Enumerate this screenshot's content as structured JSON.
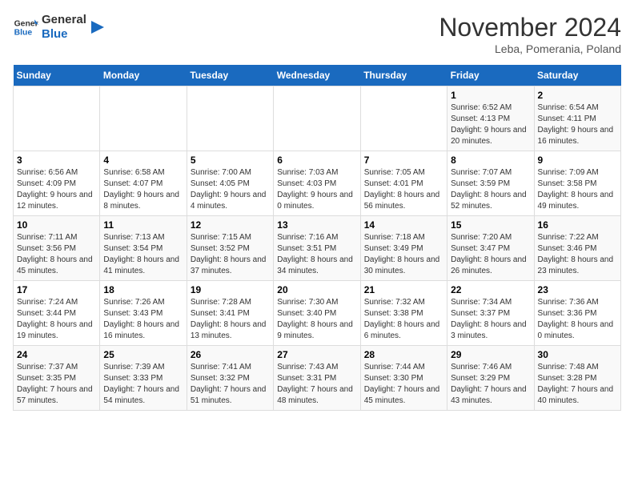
{
  "logo": {
    "text_general": "General",
    "text_blue": "Blue"
  },
  "header": {
    "month": "November 2024",
    "location": "Leba, Pomerania, Poland"
  },
  "weekdays": [
    "Sunday",
    "Monday",
    "Tuesday",
    "Wednesday",
    "Thursday",
    "Friday",
    "Saturday"
  ],
  "weeks": [
    [
      {
        "day": "",
        "info": ""
      },
      {
        "day": "",
        "info": ""
      },
      {
        "day": "",
        "info": ""
      },
      {
        "day": "",
        "info": ""
      },
      {
        "day": "",
        "info": ""
      },
      {
        "day": "1",
        "info": "Sunrise: 6:52 AM\nSunset: 4:13 PM\nDaylight: 9 hours and 20 minutes."
      },
      {
        "day": "2",
        "info": "Sunrise: 6:54 AM\nSunset: 4:11 PM\nDaylight: 9 hours and 16 minutes."
      }
    ],
    [
      {
        "day": "3",
        "info": "Sunrise: 6:56 AM\nSunset: 4:09 PM\nDaylight: 9 hours and 12 minutes."
      },
      {
        "day": "4",
        "info": "Sunrise: 6:58 AM\nSunset: 4:07 PM\nDaylight: 9 hours and 8 minutes."
      },
      {
        "day": "5",
        "info": "Sunrise: 7:00 AM\nSunset: 4:05 PM\nDaylight: 9 hours and 4 minutes."
      },
      {
        "day": "6",
        "info": "Sunrise: 7:03 AM\nSunset: 4:03 PM\nDaylight: 9 hours and 0 minutes."
      },
      {
        "day": "7",
        "info": "Sunrise: 7:05 AM\nSunset: 4:01 PM\nDaylight: 8 hours and 56 minutes."
      },
      {
        "day": "8",
        "info": "Sunrise: 7:07 AM\nSunset: 3:59 PM\nDaylight: 8 hours and 52 minutes."
      },
      {
        "day": "9",
        "info": "Sunrise: 7:09 AM\nSunset: 3:58 PM\nDaylight: 8 hours and 49 minutes."
      }
    ],
    [
      {
        "day": "10",
        "info": "Sunrise: 7:11 AM\nSunset: 3:56 PM\nDaylight: 8 hours and 45 minutes."
      },
      {
        "day": "11",
        "info": "Sunrise: 7:13 AM\nSunset: 3:54 PM\nDaylight: 8 hours and 41 minutes."
      },
      {
        "day": "12",
        "info": "Sunrise: 7:15 AM\nSunset: 3:52 PM\nDaylight: 8 hours and 37 minutes."
      },
      {
        "day": "13",
        "info": "Sunrise: 7:16 AM\nSunset: 3:51 PM\nDaylight: 8 hours and 34 minutes."
      },
      {
        "day": "14",
        "info": "Sunrise: 7:18 AM\nSunset: 3:49 PM\nDaylight: 8 hours and 30 minutes."
      },
      {
        "day": "15",
        "info": "Sunrise: 7:20 AM\nSunset: 3:47 PM\nDaylight: 8 hours and 26 minutes."
      },
      {
        "day": "16",
        "info": "Sunrise: 7:22 AM\nSunset: 3:46 PM\nDaylight: 8 hours and 23 minutes."
      }
    ],
    [
      {
        "day": "17",
        "info": "Sunrise: 7:24 AM\nSunset: 3:44 PM\nDaylight: 8 hours and 19 minutes."
      },
      {
        "day": "18",
        "info": "Sunrise: 7:26 AM\nSunset: 3:43 PM\nDaylight: 8 hours and 16 minutes."
      },
      {
        "day": "19",
        "info": "Sunrise: 7:28 AM\nSunset: 3:41 PM\nDaylight: 8 hours and 13 minutes."
      },
      {
        "day": "20",
        "info": "Sunrise: 7:30 AM\nSunset: 3:40 PM\nDaylight: 8 hours and 9 minutes."
      },
      {
        "day": "21",
        "info": "Sunrise: 7:32 AM\nSunset: 3:38 PM\nDaylight: 8 hours and 6 minutes."
      },
      {
        "day": "22",
        "info": "Sunrise: 7:34 AM\nSunset: 3:37 PM\nDaylight: 8 hours and 3 minutes."
      },
      {
        "day": "23",
        "info": "Sunrise: 7:36 AM\nSunset: 3:36 PM\nDaylight: 8 hours and 0 minutes."
      }
    ],
    [
      {
        "day": "24",
        "info": "Sunrise: 7:37 AM\nSunset: 3:35 PM\nDaylight: 7 hours and 57 minutes."
      },
      {
        "day": "25",
        "info": "Sunrise: 7:39 AM\nSunset: 3:33 PM\nDaylight: 7 hours and 54 minutes."
      },
      {
        "day": "26",
        "info": "Sunrise: 7:41 AM\nSunset: 3:32 PM\nDaylight: 7 hours and 51 minutes."
      },
      {
        "day": "27",
        "info": "Sunrise: 7:43 AM\nSunset: 3:31 PM\nDaylight: 7 hours and 48 minutes."
      },
      {
        "day": "28",
        "info": "Sunrise: 7:44 AM\nSunset: 3:30 PM\nDaylight: 7 hours and 45 minutes."
      },
      {
        "day": "29",
        "info": "Sunrise: 7:46 AM\nSunset: 3:29 PM\nDaylight: 7 hours and 43 minutes."
      },
      {
        "day": "30",
        "info": "Sunrise: 7:48 AM\nSunset: 3:28 PM\nDaylight: 7 hours and 40 minutes."
      }
    ]
  ]
}
